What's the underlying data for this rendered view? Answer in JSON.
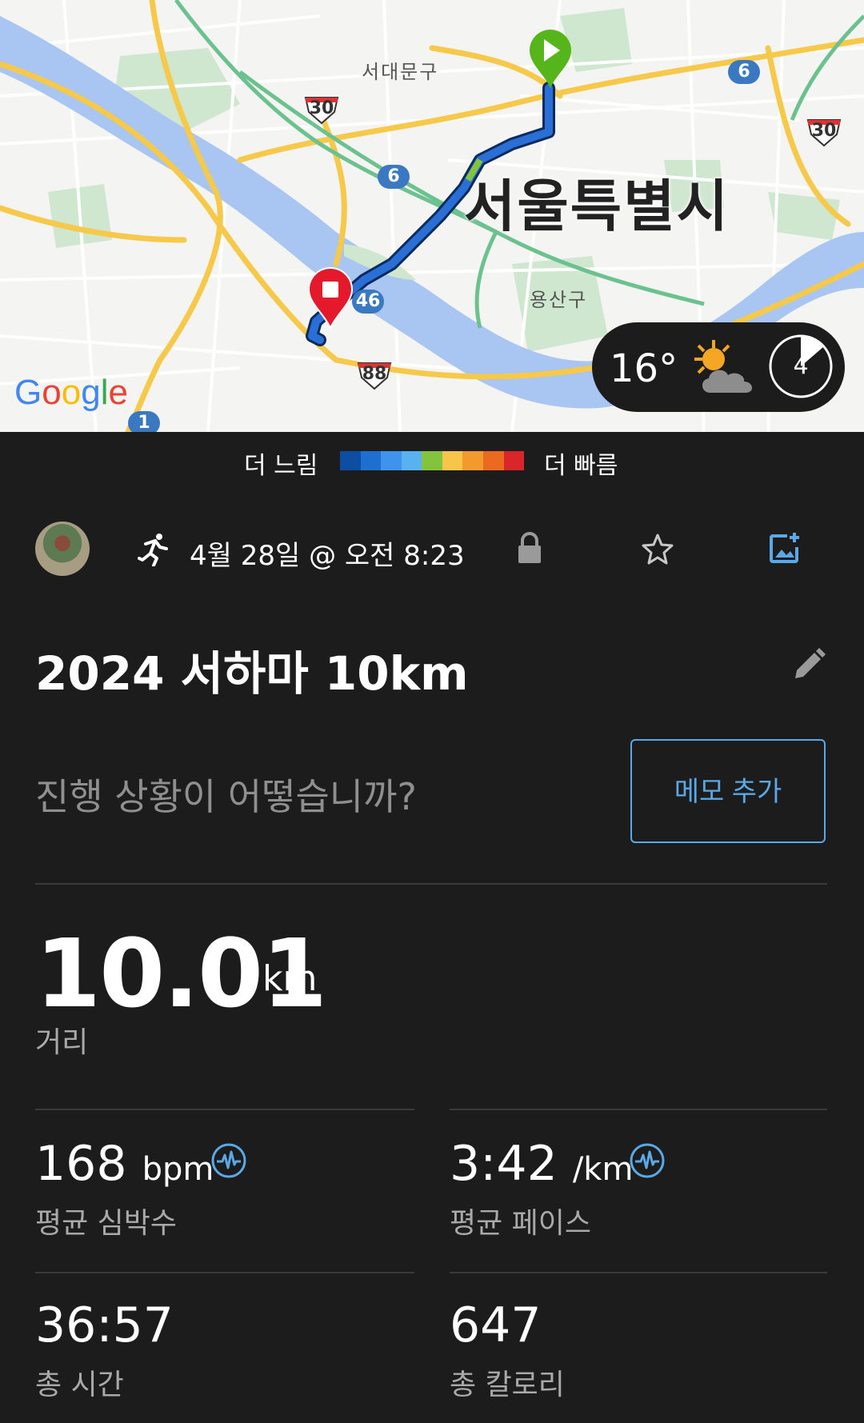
{
  "map": {
    "districts": [
      "서대문구",
      "용산구"
    ],
    "city": "서울특별시",
    "route_shields": [
      "30",
      "30",
      "88"
    ],
    "route_badges": [
      "6",
      "6",
      "46",
      "1"
    ],
    "google": [
      "G",
      "o",
      "o",
      "g",
      "l",
      "e"
    ],
    "start_marker": "play-marker",
    "end_marker": "stop-marker"
  },
  "weather": {
    "temperature": "16°",
    "condition_icon": "partly-cloudy-icon",
    "timer_value": "4"
  },
  "legend": {
    "slow_label": "더 느림",
    "fast_label": "더 빠름",
    "colors": [
      "#0b4ea2",
      "#1f6fd1",
      "#3e94ec",
      "#58b2f0",
      "#84c33c",
      "#f5c64a",
      "#f39a2e",
      "#ea6b1f",
      "#d8262b"
    ]
  },
  "activity": {
    "datetime": "4월 28일 @ 오전 8:23",
    "title": "2024 서하마 10km",
    "note_prompt": "진행 상황이 어떻습니까?",
    "memo_button": "메모 추가"
  },
  "stats": {
    "distance": {
      "value": "10.01",
      "unit": "km",
      "label": "거리"
    },
    "avg_hr": {
      "value": "168",
      "unit": "bpm",
      "label": "평균 심박수"
    },
    "avg_pace": {
      "value": "3:42",
      "unit": "/km",
      "label": "평균 페이스"
    },
    "total_time": {
      "value": "36:57",
      "label": "총 시간"
    },
    "calories": {
      "value": "647",
      "label": "총 칼로리"
    }
  },
  "colors": {
    "background": "#1c1c1c",
    "accent": "#5aa9e6",
    "secondary_text": "#a9a9a9",
    "route": "#2a6fd6",
    "start_marker": "#57b51c",
    "end_marker": "#e4192b"
  }
}
